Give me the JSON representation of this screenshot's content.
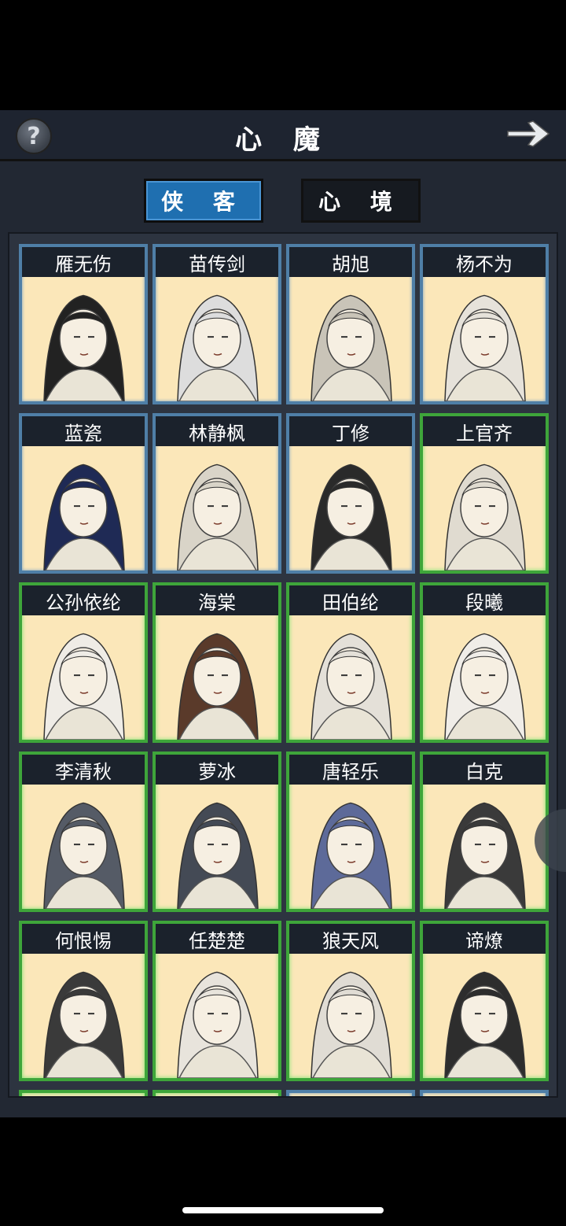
{
  "header": {
    "title": "心 魔",
    "help_label": "?"
  },
  "tabs": [
    {
      "label": "侠 客",
      "active": true
    },
    {
      "label": "心 境",
      "active": false
    }
  ],
  "colors": {
    "active_tab": "#1f6fb0",
    "rare_border": "#4f7fa7",
    "epic_border": "#3ea53a",
    "card_bg": "#fbe7b9"
  },
  "characters": [
    {
      "name": "雁无伤",
      "tier": "blue"
    },
    {
      "name": "苗传剑",
      "tier": "blue"
    },
    {
      "name": "胡旭",
      "tier": "blue"
    },
    {
      "name": "杨不为",
      "tier": "blue"
    },
    {
      "name": "蓝瓷",
      "tier": "blue"
    },
    {
      "name": "林静枫",
      "tier": "blue"
    },
    {
      "name": "丁修",
      "tier": "blue"
    },
    {
      "name": "上官齐",
      "tier": "green"
    },
    {
      "name": "公孙依纶",
      "tier": "green"
    },
    {
      "name": "海棠",
      "tier": "green"
    },
    {
      "name": "田伯纶",
      "tier": "green"
    },
    {
      "name": "段曦",
      "tier": "green"
    },
    {
      "name": "李清秋",
      "tier": "green"
    },
    {
      "name": "萝冰",
      "tier": "green"
    },
    {
      "name": "唐轻乐",
      "tier": "green"
    },
    {
      "name": "白克",
      "tier": "green"
    },
    {
      "name": "何恨惕",
      "tier": "green"
    },
    {
      "name": "任楚楚",
      "tier": "green"
    },
    {
      "name": "狼天风",
      "tier": "green"
    },
    {
      "name": "谛燎",
      "tier": "green"
    }
  ]
}
